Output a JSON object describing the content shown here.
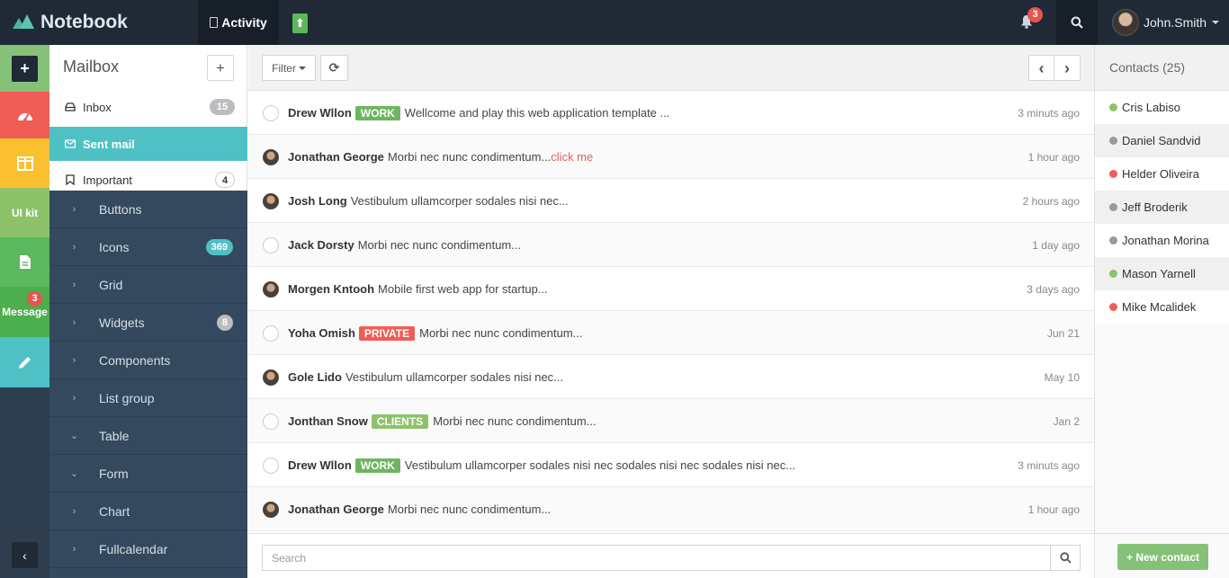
{
  "brand": {
    "name": "Notebook",
    "accent": "#48b6a3"
  },
  "topbar": {
    "activity_label": "Activity",
    "up_symbol": "⬆",
    "notifications_count": "3",
    "user_name": "John.Smith"
  },
  "rail": {
    "add_symbol": "+",
    "uikit_label": "UI kit",
    "message_label": "Message",
    "message_count": "3",
    "collapse_symbol": "‹"
  },
  "mailbox": {
    "title": "Mailbox",
    "add_symbol": "+",
    "items": [
      {
        "label": "Inbox",
        "badge": "15",
        "icon": "inbox-icon"
      },
      {
        "label": "Sent mail",
        "badge": "",
        "icon": "envelope-icon"
      },
      {
        "label": "Important",
        "badge": "4",
        "icon": "bookmark-icon"
      }
    ]
  },
  "nav": {
    "items": [
      {
        "label": "Buttons",
        "chevron": "›",
        "badge": ""
      },
      {
        "label": "Icons",
        "chevron": "›",
        "badge": "369",
        "badge_color": "#4fc1c5"
      },
      {
        "label": "Grid",
        "chevron": "›",
        "badge": ""
      },
      {
        "label": "Widgets",
        "chevron": "›",
        "badge": "8",
        "badge_color": "#bbbdc0"
      },
      {
        "label": "Components",
        "chevron": "›",
        "badge": ""
      },
      {
        "label": "List group",
        "chevron": "›",
        "badge": ""
      },
      {
        "label": "Table",
        "chevron": "⌄",
        "badge": ""
      },
      {
        "label": "Form",
        "chevron": "⌄",
        "badge": ""
      },
      {
        "label": "Chart",
        "chevron": "›",
        "badge": ""
      },
      {
        "label": "Fullcalendar",
        "chevron": "›",
        "badge": ""
      }
    ]
  },
  "toolbar": {
    "filter_label": "Filter",
    "refresh_symbol": "⟳",
    "prev_symbol": "‹",
    "next_symbol": "›"
  },
  "messages": [
    {
      "from": "Drew Wllon",
      "label": "WORK",
      "label_type": "work",
      "text": "Wellcome and play this web application template ...",
      "link": "",
      "time": "3 minuts ago",
      "avatar": "empty"
    },
    {
      "from": "Jonathan George",
      "label": "",
      "label_type": "",
      "text": "Morbi nec nunc condimentum...",
      "link": "click me",
      "time": "1 hour ago",
      "avatar": "photo"
    },
    {
      "from": "Josh Long",
      "label": "",
      "label_type": "",
      "text": "Vestibulum ullamcorper sodales nisi nec...",
      "link": "",
      "time": "2 hours ago",
      "avatar": "photo"
    },
    {
      "from": "Jack Dorsty",
      "label": "",
      "label_type": "",
      "text": "Morbi nec nunc condimentum...",
      "link": "",
      "time": "1 day ago",
      "avatar": "empty"
    },
    {
      "from": "Morgen Kntooh",
      "label": "",
      "label_type": "",
      "text": "Mobile first web app for startup...",
      "link": "",
      "time": "3 days ago",
      "avatar": "photo"
    },
    {
      "from": "Yoha Omish",
      "label": "PRIVATE",
      "label_type": "private",
      "text": "Morbi nec nunc condimentum...",
      "link": "",
      "time": "Jun 21",
      "avatar": "empty"
    },
    {
      "from": "Gole Lido",
      "label": "",
      "label_type": "",
      "text": "Vestibulum ullamcorper sodales nisi nec...",
      "link": "",
      "time": "May 10",
      "avatar": "photo"
    },
    {
      "from": "Jonthan Snow",
      "label": "CLIENTS",
      "label_type": "clients",
      "text": "Morbi nec nunc condimentum...",
      "link": "",
      "time": "Jan 2",
      "avatar": "empty"
    },
    {
      "from": "Drew Wllon",
      "label": "WORK",
      "label_type": "work",
      "text": "Vestibulum ullamcorper sodales nisi nec sodales nisi nec sodales nisi nec...",
      "link": "",
      "time": "3 minuts ago",
      "avatar": "empty"
    },
    {
      "from": "Jonathan George",
      "label": "",
      "label_type": "",
      "text": "Morbi nec nunc condimentum...",
      "link": "",
      "time": "1 hour ago",
      "avatar": "photo"
    }
  ],
  "search": {
    "placeholder": "Search",
    "value": ""
  },
  "contacts": {
    "title": "Contacts (25)",
    "items": [
      {
        "name": "Cris Labiso",
        "status_color": "#8dc26b"
      },
      {
        "name": "Daniel Sandvid",
        "status_color": "#999999"
      },
      {
        "name": "Helder Oliveira",
        "status_color": "#f05d57"
      },
      {
        "name": "Jeff Broderik",
        "status_color": "#999999"
      },
      {
        "name": "Jonathan Morina",
        "status_color": "#999999"
      },
      {
        "name": "Mason Yarnell",
        "status_color": "#8dc26b"
      },
      {
        "name": "Mike Mcalidek",
        "status_color": "#f05d57"
      }
    ],
    "new_contact_label": "+ New contact"
  }
}
